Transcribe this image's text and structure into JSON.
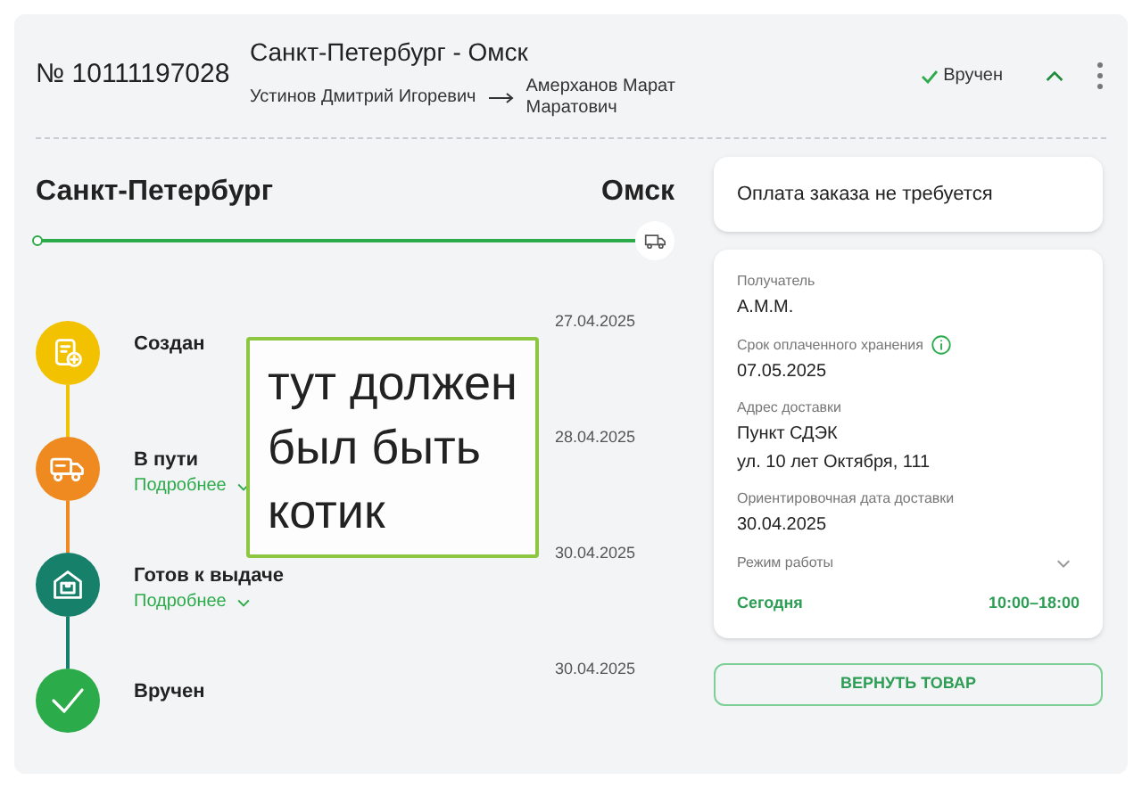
{
  "header": {
    "order_number": "№ 10111197028",
    "route": "Санкт-Петербург - Омск",
    "sender": "Устинов Дмитрий Игоревич",
    "recipient": "Амерханов Марат Маратович",
    "status": "Вручен",
    "expanded": true
  },
  "route": {
    "from": "Санкт-Петербург",
    "to": "Омск",
    "level": 1
  },
  "steps": [
    {
      "kind": "created",
      "title": "Создан",
      "date": "27.04.2025",
      "color": "#f2c200"
    },
    {
      "kind": "transit",
      "title": "В пути",
      "details": "Подробнее",
      "date": "28.04.2025",
      "color": "#ee8a1f"
    },
    {
      "kind": "ready",
      "title": "Готов к выдаче",
      "details": "Подробнее",
      "date": "30.04.2025",
      "color": "#16806b"
    },
    {
      "kind": "delivered",
      "title": "Вручен",
      "date": "30.04.2025",
      "color": "#2bab4a"
    }
  ],
  "payment": "Оплата заказа не требуется",
  "fields": [
    {
      "label": "Получатель",
      "value": [
        "А.М.М."
      ],
      "info": false
    },
    {
      "label": "Срок оплаченного хранения",
      "value": [
        "07.05.2025"
      ],
      "info": true
    },
    {
      "label": "Адрес доставки",
      "value": [
        "Пункт СДЭК",
        "ул. 10 лет Октября, 111"
      ],
      "info": false
    },
    {
      "label": "Ориентировочная дата доставки",
      "value": [
        "30.04.2025"
      ],
      "info": false
    }
  ],
  "hours": {
    "label": "Режим работы",
    "expanded": false,
    "day": "Сегодня",
    "time": "10:00–18:00"
  },
  "return_button": "ВЕРНУТЬ ТОВАР",
  "note": "тут должен был быть котик"
}
